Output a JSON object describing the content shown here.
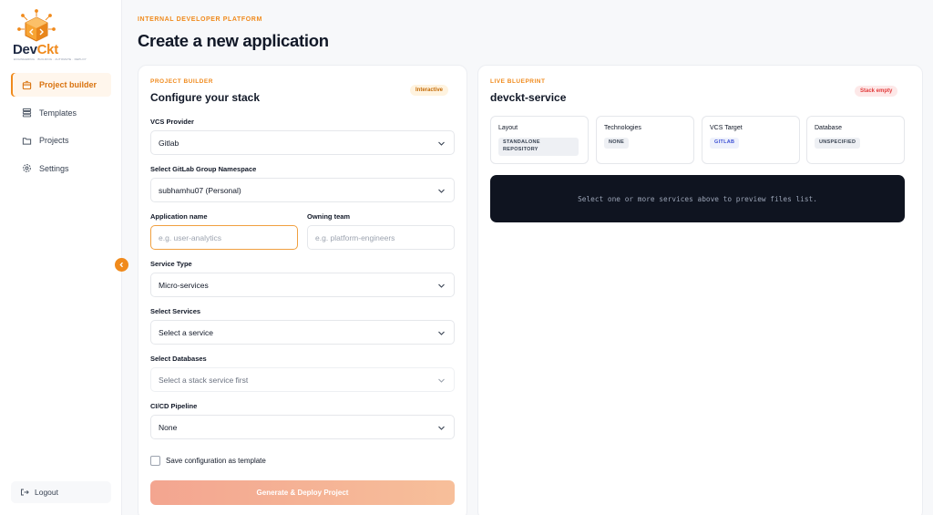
{
  "brand": {
    "name_primary": "Dev",
    "name_accent": "Ckt",
    "tagline": "ENGINEERING · BUILDING · AUTOMATE · DEPLOY"
  },
  "sidebar": {
    "items": [
      {
        "label": "Project builder",
        "icon": "box-icon",
        "active": true
      },
      {
        "label": "Templates",
        "icon": "list-icon",
        "active": false
      },
      {
        "label": "Projects",
        "icon": "folder-icon",
        "active": false
      },
      {
        "label": "Settings",
        "icon": "gear-icon",
        "active": false
      }
    ],
    "logout_label": "Logout"
  },
  "header": {
    "eyebrow": "INTERNAL DEVELOPER PLATFORM",
    "title": "Create a new application"
  },
  "builder": {
    "eyebrow": "PROJECT BUILDER",
    "title": "Configure your stack",
    "badge": "Interactive",
    "vcs_provider": {
      "label": "VCS Provider",
      "value": "Gitlab"
    },
    "namespace": {
      "label": "Select GitLab Group Namespace",
      "value": "subhamhu07 (Personal)"
    },
    "app_name": {
      "label": "Application name",
      "placeholder": "e.g. user-analytics"
    },
    "owning_team": {
      "label": "Owning team",
      "placeholder": "e.g. platform-engineers"
    },
    "service_type": {
      "label": "Service Type",
      "value": "Micro-services"
    },
    "services": {
      "label": "Select Services",
      "value": "Select a service"
    },
    "databases": {
      "label": "Select Databases",
      "value": "Select a stack service first"
    },
    "cicd": {
      "label": "CI/CD Pipeline",
      "value": "None"
    },
    "save_template_label": "Save configuration as template",
    "generate_label": "Generate & Deploy Project"
  },
  "blueprint": {
    "eyebrow": "LIVE BLUEPRINT",
    "title": "devckt-service",
    "badge": "Stack empty",
    "tiles": [
      {
        "label": "Layout",
        "tag": "STANDALONE REPOSITORY"
      },
      {
        "label": "Technologies",
        "tag": "NONE"
      },
      {
        "label": "VCS Target",
        "tag": "GITLAB"
      },
      {
        "label": "Database",
        "tag": "UNSPECIFIED"
      }
    ],
    "preview_message": "Select one or more services above to preview files list."
  },
  "colors": {
    "accent": "#f08a1c",
    "danger_badge": "#e23b3b",
    "terminal_bg": "#0f1420"
  }
}
